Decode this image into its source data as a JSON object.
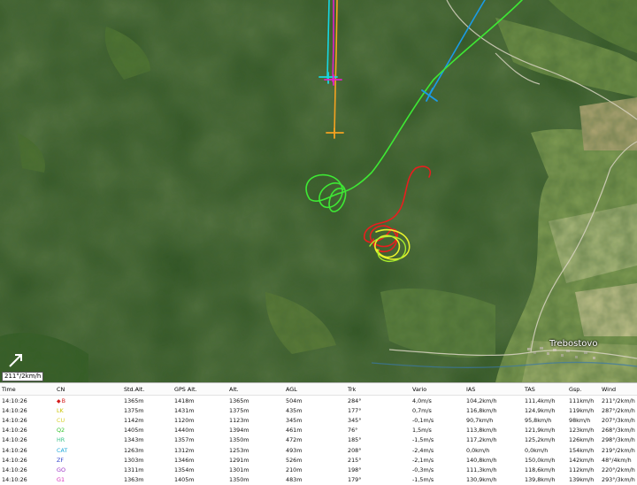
{
  "map": {
    "place_label": "Trebostovo",
    "wind_readout": "211°/2km/h",
    "colors": {
      "forest_dark": "#1d3b16",
      "forest": "#2e5422",
      "meadow": "#7f9a55",
      "field_light": "#b8bd85"
    },
    "tracks": [
      {
        "name": "cyan-track",
        "color": "#17d7e3"
      },
      {
        "name": "magenta-track",
        "color": "#e021c9"
      },
      {
        "name": "orange-track",
        "color": "#f4a221"
      },
      {
        "name": "blue-track",
        "color": "#1b9be6"
      },
      {
        "name": "green-track",
        "color": "#3ee834"
      },
      {
        "name": "red-track",
        "color": "#e81e1e"
      },
      {
        "name": "yellow-track",
        "color": "#e7f22b"
      },
      {
        "name": "lime-track",
        "color": "#a6ea2c"
      }
    ]
  },
  "table": {
    "headers": [
      "Time",
      "CN",
      "Std.Alt.",
      "GPS Alt.",
      "Alt.",
      "AGL",
      "Trk",
      "Vario",
      "IAS",
      "TAS",
      "Gsp.",
      "Wind"
    ],
    "rows": [
      {
        "time": "14:10:26",
        "cn": "B",
        "cn_color": "#d41a1a",
        "marker": "◆",
        "std_alt": "1365m",
        "gps_alt": "1418m",
        "alt": "1365m",
        "agl": "504m",
        "trk": "284°",
        "vario": "4,0m/s",
        "ias": "104,2km/h",
        "tas": "111,4km/h",
        "gsp": "111km/h",
        "wind": "211°/2km/h"
      },
      {
        "time": "14:10:26",
        "cn": "LK",
        "cn_color": "#c9c400",
        "marker": "",
        "std_alt": "1375m",
        "gps_alt": "1431m",
        "alt": "1375m",
        "agl": "435m",
        "trk": "177°",
        "vario": "0,7m/s",
        "ias": "116,8km/h",
        "tas": "124,9km/h",
        "gsp": "119km/h",
        "wind": "287°/2km/h"
      },
      {
        "time": "14:10:26",
        "cn": "CU",
        "cn_color": "#d7d22c",
        "marker": "",
        "std_alt": "1142m",
        "gps_alt": "1120m",
        "alt": "1123m",
        "agl": "345m",
        "trk": "345°",
        "vario": "-0,1m/s",
        "ias": "90,7km/h",
        "tas": "95,8km/h",
        "gsp": "98km/h",
        "wind": "207°/3km/h"
      },
      {
        "time": "14:10:26",
        "cn": "Q2",
        "cn_color": "#34c32b",
        "marker": "",
        "std_alt": "1405m",
        "gps_alt": "1440m",
        "alt": "1394m",
        "agl": "461m",
        "trk": "76°",
        "vario": "1,5m/s",
        "ias": "113,8km/h",
        "tas": "121,9km/h",
        "gsp": "123km/h",
        "wind": "268°/3km/h"
      },
      {
        "time": "14:10:26",
        "cn": "HR",
        "cn_color": "#3dc48a",
        "marker": "",
        "std_alt": "1343m",
        "gps_alt": "1357m",
        "alt": "1350m",
        "agl": "472m",
        "trk": "185°",
        "vario": "-1,5m/s",
        "ias": "117,2km/h",
        "tas": "125,2km/h",
        "gsp": "126km/h",
        "wind": "298°/3km/h"
      },
      {
        "time": "14:10:26",
        "cn": "CAT",
        "cn_color": "#1fa9d9",
        "marker": "",
        "std_alt": "1263m",
        "gps_alt": "1312m",
        "alt": "1253m",
        "agl": "493m",
        "trk": "208°",
        "vario": "-2,4m/s",
        "ias": "0,0km/h",
        "tas": "0,0km/h",
        "gsp": "154km/h",
        "wind": "219°/2km/h"
      },
      {
        "time": "14:10:26",
        "cn": "ZF",
        "cn_color": "#3344cc",
        "marker": "",
        "std_alt": "1303m",
        "gps_alt": "1346m",
        "alt": "1291m",
        "agl": "526m",
        "trk": "215°",
        "vario": "-2,1m/s",
        "ias": "140,8km/h",
        "tas": "150,0km/h",
        "gsp": "142km/h",
        "wind": "48°/4km/h"
      },
      {
        "time": "14:10:26",
        "cn": "GO",
        "cn_color": "#9a2fc4",
        "marker": "",
        "std_alt": "1311m",
        "gps_alt": "1354m",
        "alt": "1301m",
        "agl": "210m",
        "trk": "198°",
        "vario": "-0,3m/s",
        "ias": "111,3km/h",
        "tas": "118,6km/h",
        "gsp": "112km/h",
        "wind": "220°/2km/h"
      },
      {
        "time": "14:10:26",
        "cn": "G1",
        "cn_color": "#d42ab8",
        "marker": "",
        "std_alt": "1363m",
        "gps_alt": "1405m",
        "alt": "1350m",
        "agl": "483m",
        "trk": "179°",
        "vario": "-1,5m/s",
        "ias": "130,9km/h",
        "tas": "139,8km/h",
        "gsp": "139km/h",
        "wind": "293°/3km/h"
      }
    ]
  }
}
